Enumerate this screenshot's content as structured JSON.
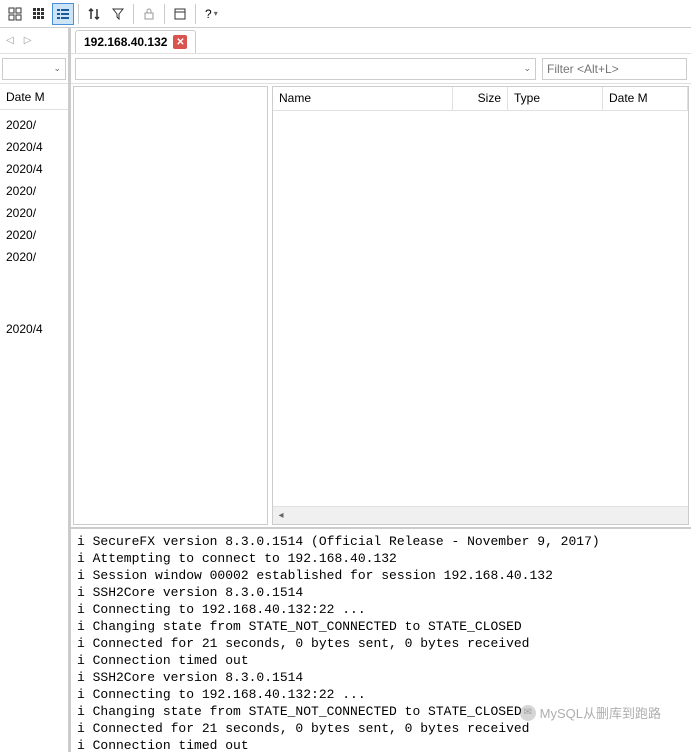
{
  "toolbar": {
    "help_label": "?"
  },
  "tab": {
    "label": "192.168.40.132"
  },
  "filter": {
    "placeholder": "Filter <Alt+L>"
  },
  "left": {
    "header": "Date M",
    "dates_top": [
      "2020/",
      "2020/4",
      "2020/4",
      "2020/",
      "2020/",
      "2020/",
      "2020/"
    ],
    "dates_bottom": [
      "2020/4"
    ]
  },
  "columns": {
    "name": "Name",
    "size": "Size",
    "type": "Type",
    "date": "Date M"
  },
  "log_lines": [
    "i SecureFX version 8.3.0.1514 (Official Release - November 9, 2017)",
    "i Attempting to connect to 192.168.40.132",
    "i Session window 00002 established for session 192.168.40.132",
    "i SSH2Core version 8.3.0.1514",
    "i Connecting to 192.168.40.132:22 ...",
    "i Changing state from STATE_NOT_CONNECTED to STATE_CLOSED",
    "i Connected for 21 seconds, 0 bytes sent, 0 bytes received",
    "i Connection timed out",
    "i SSH2Core version 8.3.0.1514",
    "i Connecting to 192.168.40.132:22 ...",
    "i Changing state from STATE_NOT_CONNECTED to STATE_CLOSED",
    "i Connected for 21 seconds, 0 bytes sent, 0 bytes received",
    "i Connection timed out"
  ],
  "watermark": "MySQL从删库到跑路"
}
